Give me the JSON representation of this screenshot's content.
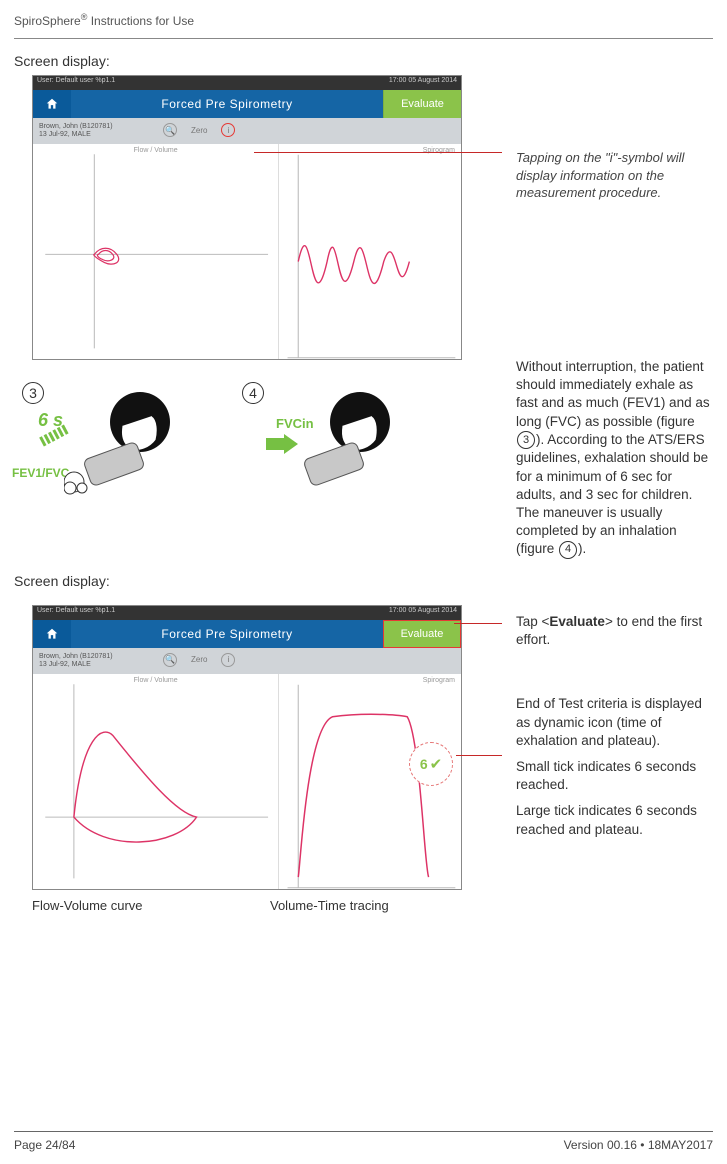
{
  "header": {
    "product": "SpiroSphere",
    "suffix": "Instructions for Use"
  },
  "labels": {
    "screen_display": "Screen display:",
    "flow_volume": "Flow-Volume curve",
    "volume_time": "Volume-Time tracing"
  },
  "shot_common": {
    "status_left": "User: Default user %p1.1",
    "status_right": "17:00 05 August 2014",
    "title": "Forced Pre Spirometry",
    "evaluate": "Evaluate",
    "patient_name": "Brown, John (B120781)",
    "patient_sub": "13 Jul-92, MALE",
    "zero": "Zero",
    "flow_vol": "Flow / Volume",
    "spirogram": "Spirogram"
  },
  "annotations": {
    "info": "Tapping on the \"i\"-symbol will display information on the measurement procedure.",
    "instr_part1": "Without interruption, the patient should immediately exhale as fast and as much (FEV1) and as long (FVC) as possible (figure ",
    "instr_part2": "). According to the ATS/ERS guidelines, exhalation should be for a minimum of 6 sec for adults, and 3 sec for children. The maneuver is usually completed by an inhalation (figure ",
    "instr_part3": ").",
    "tap_eval_pre": "Tap <",
    "tap_eval_bold": "Evaluate",
    "tap_eval_post": "> to end the first effort.",
    "eot1": "End of Test criteria is displayed as dynamic icon (time of exhalation and plateau).",
    "eot2": "Small tick indicates 6 seconds reached.",
    "eot3": "Large tick indicates 6 seconds reached and plateau."
  },
  "figures": {
    "num3": "3",
    "num4": "4",
    "six_s": "6 s",
    "fev": "FEV1/FVC",
    "fvcin": "FVCin",
    "inline3": "3",
    "inline4": "4"
  },
  "eot_badge": {
    "six": "6"
  },
  "footer": {
    "page": "Page 24/84",
    "version": "Version 00.16 • 18MAY2017"
  }
}
